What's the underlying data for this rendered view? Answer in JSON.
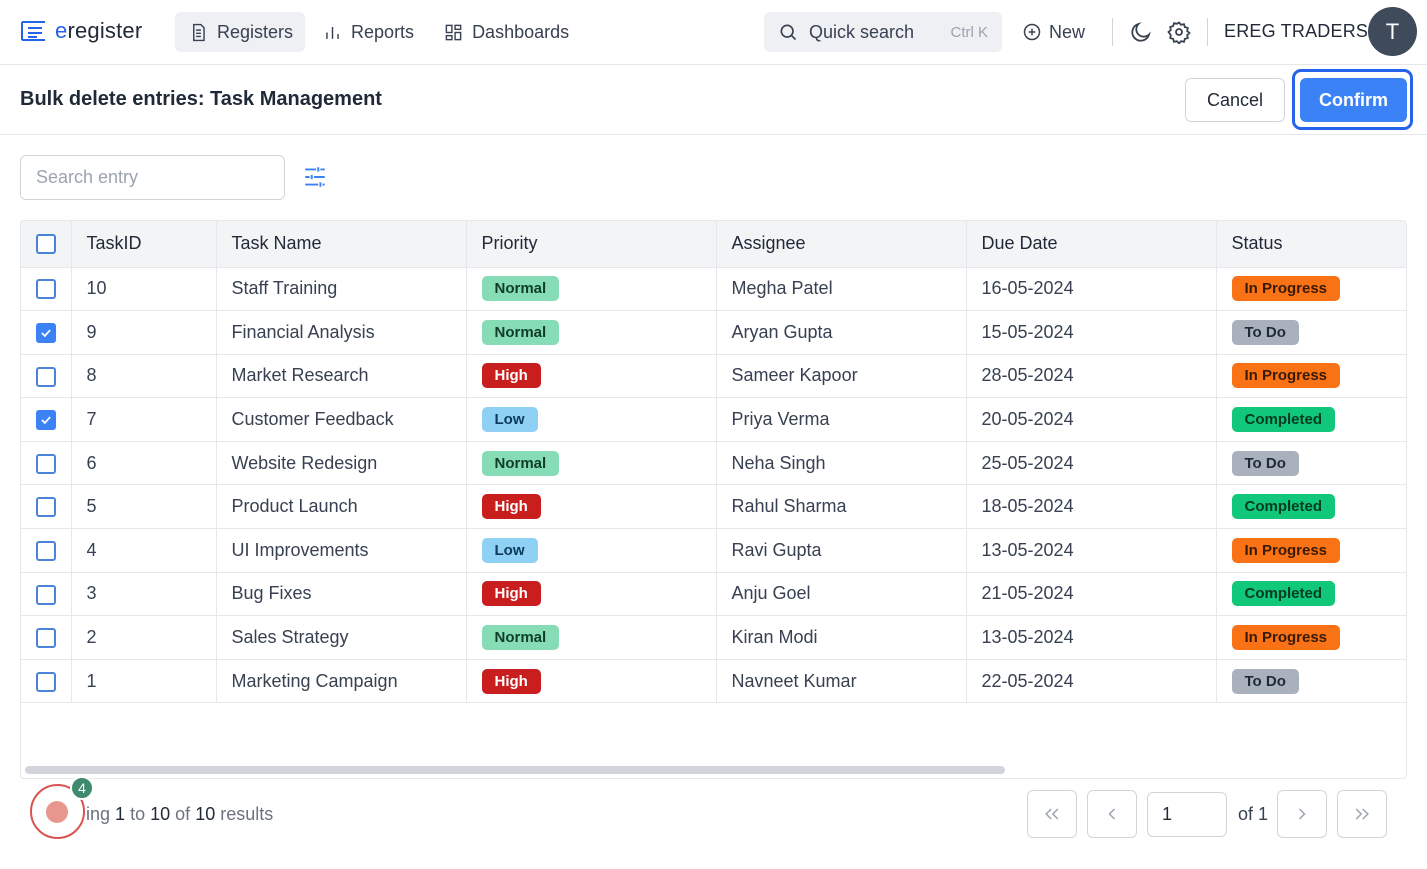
{
  "app": {
    "logo_prefix": "e",
    "logo_rest": "register"
  },
  "nav": [
    {
      "label": "Registers",
      "icon": "document-icon",
      "active": true
    },
    {
      "label": "Reports",
      "icon": "bar-chart-icon",
      "active": false
    },
    {
      "label": "Dashboards",
      "icon": "grid-icon",
      "active": false
    }
  ],
  "quick_search": {
    "label": "Quick search",
    "shortcut": "Ctrl K"
  },
  "new_label": "New",
  "org_name": "EREG TRADERS",
  "avatar_initial": "T",
  "page": {
    "title": "Bulk delete entries: Task Management",
    "cancel_label": "Cancel",
    "confirm_label": "Confirm"
  },
  "search": {
    "placeholder": "Search entry",
    "value": ""
  },
  "table": {
    "columns": [
      "TaskID",
      "Task Name",
      "Priority",
      "Assignee",
      "Due Date",
      "Status"
    ],
    "rows": [
      {
        "selected": false,
        "id": "10",
        "name": "Staff Training",
        "priority": "Normal",
        "assignee": "Megha Patel",
        "due": "16-05-2024",
        "status": "In Progress"
      },
      {
        "selected": true,
        "id": "9",
        "name": "Financial Analysis",
        "priority": "Normal",
        "assignee": "Aryan Gupta",
        "due": "15-05-2024",
        "status": "To Do"
      },
      {
        "selected": false,
        "id": "8",
        "name": "Market Research",
        "priority": "High",
        "assignee": "Sameer Kapoor",
        "due": "28-05-2024",
        "status": "In Progress"
      },
      {
        "selected": true,
        "id": "7",
        "name": "Customer Feedback",
        "priority": "Low",
        "assignee": "Priya Verma",
        "due": "20-05-2024",
        "status": "Completed"
      },
      {
        "selected": false,
        "id": "6",
        "name": "Website Redesign",
        "priority": "Normal",
        "assignee": "Neha Singh",
        "due": "25-05-2024",
        "status": "To Do"
      },
      {
        "selected": false,
        "id": "5",
        "name": "Product Launch",
        "priority": "High",
        "assignee": "Rahul Sharma",
        "due": "18-05-2024",
        "status": "Completed"
      },
      {
        "selected": false,
        "id": "4",
        "name": "UI Improvements",
        "priority": "Low",
        "assignee": "Ravi Gupta",
        "due": "13-05-2024",
        "status": "In Progress"
      },
      {
        "selected": false,
        "id": "3",
        "name": "Bug Fixes",
        "priority": "High",
        "assignee": "Anju Goel",
        "due": "21-05-2024",
        "status": "Completed"
      },
      {
        "selected": false,
        "id": "2",
        "name": "Sales Strategy",
        "priority": "Normal",
        "assignee": "Kiran Modi",
        "due": "13-05-2024",
        "status": "In Progress"
      },
      {
        "selected": false,
        "id": "1",
        "name": "Marketing Campaign",
        "priority": "High",
        "assignee": "Navneet Kumar",
        "due": "22-05-2024",
        "status": "To Do"
      }
    ]
  },
  "badge_colors": {
    "priority": {
      "Normal": {
        "bg": "#86dcb4",
        "fg": "#0f3d2a"
      },
      "High": {
        "bg": "#c81e1e",
        "fg": "#ffffff"
      },
      "Low": {
        "bg": "#8fd0f5",
        "fg": "#0c3a5a"
      }
    },
    "status": {
      "In Progress": {
        "bg": "#f97316",
        "fg": "#3b1a05"
      },
      "To Do": {
        "bg": "#a9b1bd",
        "fg": "#1f2937"
      },
      "Completed": {
        "bg": "#10c77a",
        "fg": "#063b23"
      }
    }
  },
  "footer": {
    "showing_prefix": "ing",
    "from": "1",
    "to_word": "to",
    "to": "10",
    "of_word": "of",
    "total": "10",
    "results_word": "results",
    "recording_count": "4"
  },
  "pagination": {
    "current_page": "1",
    "of_label": "of 1"
  },
  "accent_color": "#3b82f6"
}
